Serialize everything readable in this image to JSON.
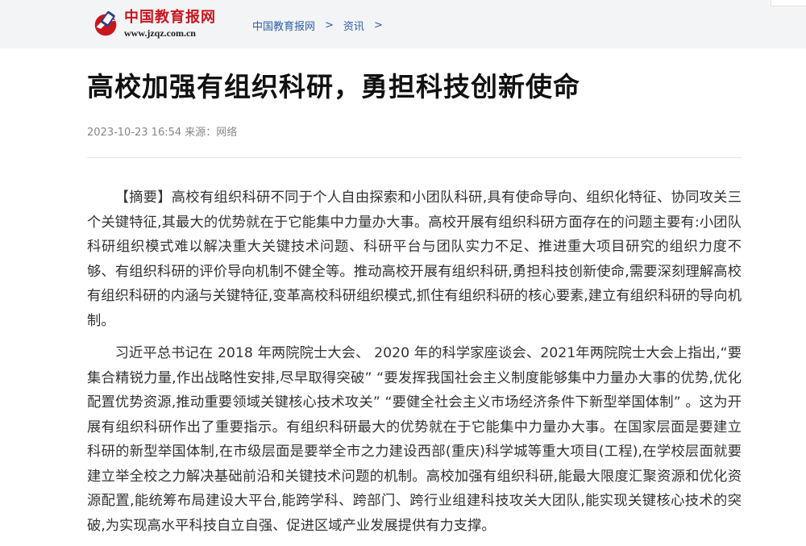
{
  "header": {
    "logo": {
      "name_cn": "中国教育报网",
      "url": "www.jzqz.com.cn"
    },
    "breadcrumb": {
      "items": [
        "中国教育报网",
        "资讯"
      ],
      "separator": ">"
    }
  },
  "article": {
    "title": "高校加强有组织科研，勇担科技创新使命",
    "date": "2023-10-23 16:54",
    "source": "来源：网络",
    "paragraphs": [
      "【摘要】高校有组织科研不同于个人自由探索和小团队科研,具有使命导向、组织化特征、协同攻关三个关键特征,其最大的优势就在于它能集中力量办大事。高校开展有组织科研方面存在的问题主要有:小团队科研组织模式难以解决重大关键技术问题、科研平台与团队实力不足、推进重大项目研究的组织力度不够、有组织科研的评价导向机制不健全等。推动高校开展有组织科研,勇担科技创新使命,需要深刻理解高校有组织科研的内涵与关键特征,变革高校科研组织模式,抓住有组织科研的核心要素,建立有组织科研的导向机制。",
      "习近平总书记在 2018 年两院院士大会、 2020 年的科学家座谈会、2021年两院院士大会上指出,“要集合精锐力量,作出战略性安排,尽早取得突破” “要发挥我国社会主义制度能够集中力量办大事的优势,优化配置优势资源,推动重要领域关键核心技术攻关” “要健全社会主义市场经济条件下新型举国体制” 。这为开展有组织科研作出了重要指示。有组织科研最大的优势就在于它能集中力量办大事。在国家层面是要建立科研的新型举国体制,在市级层面是要举全市之力建设西部(重庆)科学城等重大项目(工程),在学校层面就要建立举全校之力解决基础前沿和关键技术问题的机制。高校加强有组织科研,能最大限度汇聚资源和优化资源配置,能统筹布局建设大平台,能跨学科、跨部门、跨行业组建科技攻关大团队,能实现关键核心技术的突破,为实现高水平科技自立自强、促进区域产业发展提供有力支撑。"
    ]
  },
  "colors": {
    "header_bg": "#f3f4f6",
    "logo_red": "#c8161d",
    "link_blue": "#2d5fa8",
    "body_text": "#333333",
    "meta_text": "#888888"
  }
}
